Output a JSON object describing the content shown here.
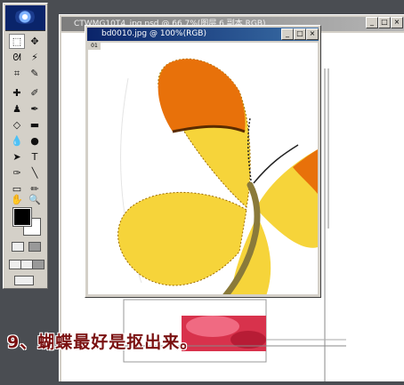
{
  "back_window": {
    "title": "CTWMG10T4_ipg.psd @ 66.7%(图层 6 副本,RGB)",
    "btn_min": "_",
    "btn_max": "□",
    "btn_close": "×"
  },
  "front_window": {
    "title": "bd0010.jpg @ 100%(RGB)",
    "btn_min": "_",
    "btn_max": "□",
    "btn_close": "×",
    "ruler_label": "01"
  },
  "caption": "9、蝴蝶最好是抠出来。",
  "colors": {
    "foreground": "#000000",
    "background": "#ffffff",
    "butterfly_yellow": "#f6d43a",
    "butterfly_orange": "#e8710a"
  },
  "tools": [
    "marquee-tool",
    "move-tool",
    "lasso-tool",
    "magic-wand-tool",
    "crop-tool",
    "slice-tool",
    "healing-brush-tool",
    "brush-tool",
    "clone-stamp-tool",
    "history-brush-tool",
    "eraser-tool",
    "gradient-tool",
    "blur-tool",
    "dodge-tool",
    "path-selection-tool",
    "type-tool",
    "pen-tool",
    "line-tool",
    "notes-tool",
    "eyedropper-tool",
    "hand-tool",
    "zoom-tool"
  ]
}
